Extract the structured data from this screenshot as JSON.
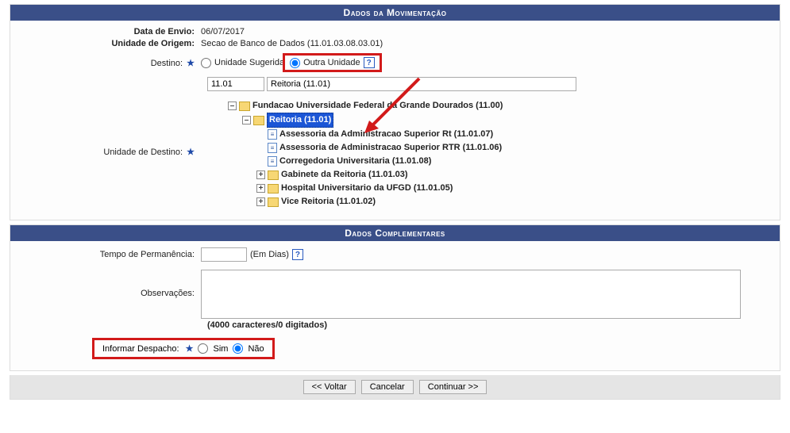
{
  "section1": {
    "title": "Dados da Movimentação",
    "data_envio_label": "Data de Envio:",
    "data_envio_value": "06/07/2017",
    "unidade_origem_label": "Unidade de Origem:",
    "unidade_origem_value": "Secao de Banco de Dados (11.01.03.08.03.01)",
    "destino_label": "Destino:",
    "radio_unidade_sugerida": "Unidade Sugerida",
    "radio_outra_unidade": "Outra Unidade",
    "unit_code_value": "11.01",
    "unit_name_value": "Reitoria (11.01)",
    "unidade_destino_label": "Unidade de Destino:",
    "tree": {
      "root_label": "Fundacao Universidade Federal da Grande Dourados (11.00)",
      "reitoria_label": "Reitoria (11.01)",
      "assessoria_rt": "Assessoria da Administracao Superior Rt (11.01.07)",
      "assessoria_rtr": "Assessoria de Administracao Superior RTR (11.01.06)",
      "corregedoria": "Corregedoria Universitaria (11.01.08)",
      "gabinete": "Gabinete da Reitoria (11.01.03)",
      "hospital": "Hospital Universitario da UFGD (11.01.05)",
      "vice_reitoria": "Vice Reitoria (11.01.02)"
    }
  },
  "section2": {
    "title": "Dados Complementares",
    "tempo_label": "Tempo de Permanência:",
    "tempo_value": "",
    "tempo_suffix": "(Em Dias)",
    "obs_label": "Observações:",
    "obs_value": "",
    "counter": "(4000 caracteres/0 digitados)",
    "despacho_label": "Informar Despacho:",
    "despacho_sim": "Sim",
    "despacho_nao": "Não"
  },
  "buttons": {
    "voltar": "<< Voltar",
    "cancelar": "Cancelar",
    "continuar": "Continuar >>"
  }
}
